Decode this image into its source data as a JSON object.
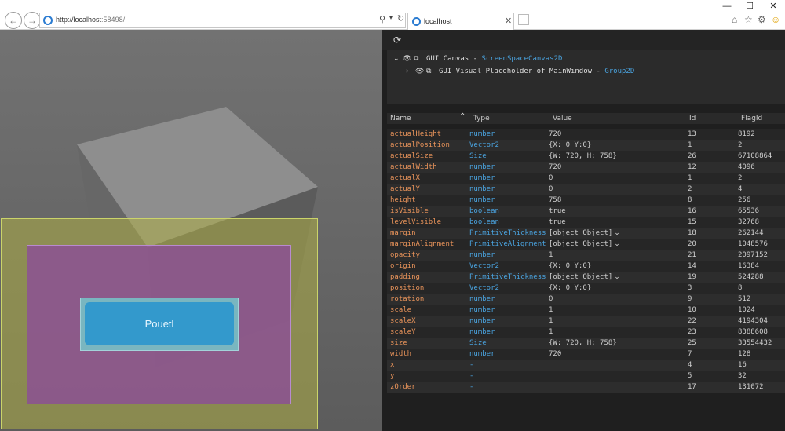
{
  "browser": {
    "address_host": "http://localhost",
    "address_port": ":58498/",
    "tab_title": "localhost",
    "tab_close": "✕",
    "window_controls": {
      "minimize": "—",
      "maximize": "☐",
      "close": "✕"
    },
    "icons": [
      "back-icon",
      "forward-icon",
      "search-icon",
      "dropdown-icon",
      "refresh-icon",
      "home-icon",
      "star-icon",
      "gear-icon",
      "smiley-icon"
    ]
  },
  "scene": {
    "button_label": "Pouetl",
    "cube_top_color": "#8e8e8e",
    "cube_left_color": "#676767",
    "cube_right_color": "#5c5c5c",
    "green_rect_color": "#aeae46",
    "magenta_rect_color": "#8c46a0",
    "button_color": "#3399cc"
  },
  "panel": {
    "refresh_icon": "⟳",
    "tree": [
      {
        "arrow": "⌄",
        "name": "GUI Canvas",
        "sep": " - ",
        "type": "ScreenSpaceCanvas2D"
      },
      {
        "arrow": "›",
        "name": "GUI Visual Placeholder of MainWindow",
        "sep": " - ",
        "type": "Group2D"
      }
    ],
    "columns": {
      "name": "Name",
      "type": "Type",
      "value": "Value",
      "id": "Id",
      "flag": "FlagId"
    },
    "rows": [
      {
        "name": "actualHeight",
        "type": "number",
        "value": "720",
        "id": "13",
        "flag": "8192"
      },
      {
        "name": "actualPosition",
        "type": "Vector2",
        "value": "{X: 0 Y:0}",
        "id": "1",
        "flag": "2"
      },
      {
        "name": "actualSize",
        "type": "Size",
        "value": "{W: 720, H: 758}",
        "id": "26",
        "flag": "67108864"
      },
      {
        "name": "actualWidth",
        "type": "number",
        "value": "720",
        "id": "12",
        "flag": "4096"
      },
      {
        "name": "actualX",
        "type": "number",
        "value": "0",
        "id": "1",
        "flag": "2"
      },
      {
        "name": "actualY",
        "type": "number",
        "value": "0",
        "id": "2",
        "flag": "4"
      },
      {
        "name": "height",
        "type": "number",
        "value": "758",
        "id": "8",
        "flag": "256"
      },
      {
        "name": "isVisible",
        "type": "boolean",
        "value": "true",
        "id": "16",
        "flag": "65536"
      },
      {
        "name": "levelVisible",
        "type": "boolean",
        "value": "true",
        "id": "15",
        "flag": "32768"
      },
      {
        "name": "margin",
        "type": "PrimitiveThickness",
        "value": "[object Object]",
        "chev": "⌄",
        "id": "18",
        "flag": "262144"
      },
      {
        "name": "marginAlignment",
        "type": "PrimitiveAlignment",
        "value": "[object Object]",
        "chev": "⌄",
        "id": "20",
        "flag": "1048576"
      },
      {
        "name": "opacity",
        "type": "number",
        "value": "1",
        "id": "21",
        "flag": "2097152"
      },
      {
        "name": "origin",
        "type": "Vector2",
        "value": "{X: 0 Y:0}",
        "id": "14",
        "flag": "16384"
      },
      {
        "name": "padding",
        "type": "PrimitiveThickness",
        "value": "[object Object]",
        "chev": "⌄",
        "id": "19",
        "flag": "524288"
      },
      {
        "name": "position",
        "type": "Vector2",
        "value": "{X: 0 Y:0}",
        "id": "3",
        "flag": "8"
      },
      {
        "name": "rotation",
        "type": "number",
        "value": "0",
        "id": "9",
        "flag": "512"
      },
      {
        "name": "scale",
        "type": "number",
        "value": "1",
        "id": "10",
        "flag": "1024"
      },
      {
        "name": "scaleX",
        "type": "number",
        "value": "1",
        "id": "22",
        "flag": "4194304"
      },
      {
        "name": "scaleY",
        "type": "number",
        "value": "1",
        "id": "23",
        "flag": "8388608"
      },
      {
        "name": "size",
        "type": "Size",
        "value": "{W: 720, H: 758}",
        "id": "25",
        "flag": "33554432"
      },
      {
        "name": "width",
        "type": "number",
        "value": "720",
        "id": "7",
        "flag": "128"
      },
      {
        "name": "x",
        "type": "-",
        "value": "",
        "id": "4",
        "flag": "16"
      },
      {
        "name": "y",
        "type": "-",
        "value": "",
        "id": "5",
        "flag": "32"
      },
      {
        "name": "zOrder",
        "type": "-",
        "value": "",
        "id": "17",
        "flag": "131072"
      }
    ]
  }
}
